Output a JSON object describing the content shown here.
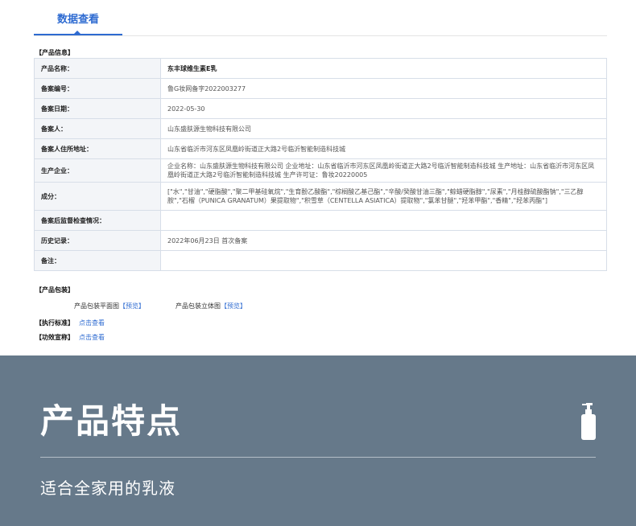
{
  "tab": {
    "label": "数据查看"
  },
  "section_info": "【产品信息】",
  "rows": [
    {
      "key": "产品名称：",
      "value": "东丰球维生素E乳"
    },
    {
      "key": "备案编号：",
      "value": "鲁G妆网备字2022003277"
    },
    {
      "key": "备案日期：",
      "value": "2022-05-30"
    },
    {
      "key": "备案人：",
      "value": "山东盛肤源生物科技有限公司"
    },
    {
      "key": "备案人住所地址：",
      "value": "山东省临沂市河东区凤凰岭街道正大路2号临沂智能制造科技城"
    },
    {
      "key": "生产企业：",
      "value": "企业名称：山东盛肤源生物科技有限公司 企业地址：山东省临沂市河东区凤凰岭街道正大路2号临沂智能制造科技城 生产地址：山东省临沂市河东区凤凰岭街道正大路2号临沂智能制造科技城 生产许可证：鲁妆20220005"
    },
    {
      "key": "成分：",
      "value": "[\"水\",\"甘油\",\"硬脂酸\",\"聚二甲基硅氧烷\",\"生育酚乙酸酯\",\"棕榈酸乙基己酯\",\"辛酸/癸酸甘油三酯\",\"鲸蜡硬脂醇\",\"尿素\",\"月桂醇硫酸酯钠\",\"三乙醇胺\",\"石榴（PUNICA GRANATUM）果提取物\",\"积雪草（CENTELLA ASIATICA）提取物\",\"氯苯甘醚\",\"羟苯甲酯\",\"香精\",\"羟苯丙酯\"]"
    },
    {
      "key": "备案后监督检查情况：",
      "value": ""
    },
    {
      "key": "历史记录：",
      "value": "2022年06月23日 首次备案"
    },
    {
      "key": "备注：",
      "value": ""
    }
  ],
  "section_pkg": "【产品包装】",
  "pkg": {
    "flat_label": "产品包装平面图",
    "flat_link": "【预览】",
    "solid_label": "产品包装立体图",
    "solid_link": "【预览】"
  },
  "standard": {
    "label": "【执行标准】",
    "link": "点击查看"
  },
  "efficacy": {
    "label": "【功效宣称】",
    "link": "点击查看"
  },
  "feature": {
    "title": "产品特点",
    "subtitle": "适合全家用的乳液",
    "icon": "lotion-bottle-icon"
  },
  "colors": {
    "accent": "#2e6bd1",
    "banner": "#66798a"
  }
}
